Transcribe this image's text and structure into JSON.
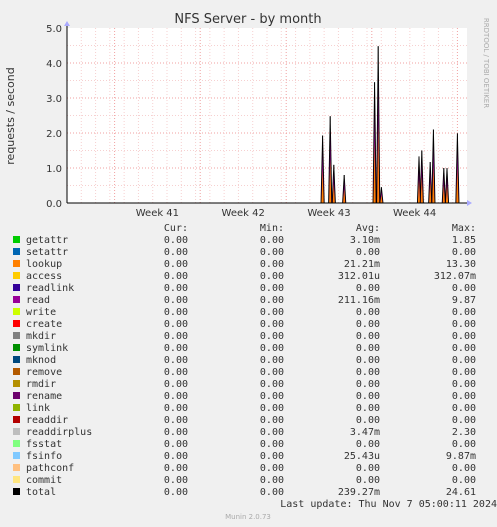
{
  "chart_data": {
    "type": "area",
    "title": "NFS Server - by month",
    "ylabel": "requests / second",
    "watermark": "RRDTOOL / TOBI OETIKER",
    "footer": "Munin 2.0.73",
    "ylim": [
      0,
      5
    ],
    "yticks": [
      "0.0",
      "1.0",
      "2.0",
      "3.0",
      "4.0",
      "5.0"
    ],
    "week_labels": [
      "Week 41",
      "Week 42",
      "Week 43",
      "Week 44"
    ],
    "grid": true,
    "spikes": [
      {
        "x": 0.639,
        "v": 1.93
      },
      {
        "x": 0.658,
        "v": 2.48
      },
      {
        "x": 0.667,
        "v": 1.09
      },
      {
        "x": 0.693,
        "v": 0.8
      },
      {
        "x": 0.769,
        "v": 3.45
      },
      {
        "x": 0.778,
        "v": 4.48
      },
      {
        "x": 0.786,
        "v": 0.45
      },
      {
        "x": 0.88,
        "v": 1.33
      },
      {
        "x": 0.887,
        "v": 1.5
      },
      {
        "x": 0.908,
        "v": 1.17
      },
      {
        "x": 0.916,
        "v": 2.1
      },
      {
        "x": 0.942,
        "v": 1.0
      },
      {
        "x": 0.95,
        "v": 1.0
      },
      {
        "x": 0.976,
        "v": 1.99
      }
    ],
    "headers": [
      "Cur:",
      "Min:",
      "Avg:",
      "Max:"
    ],
    "series": [
      {
        "name": "getattr",
        "color": "#00cc00",
        "cur": "0.00",
        "min": "0.00",
        "avg": "3.10m",
        "max": "1.85"
      },
      {
        "name": "setattr",
        "color": "#0066b3",
        "cur": "0.00",
        "min": "0.00",
        "avg": "0.00",
        "max": "0.00"
      },
      {
        "name": "lookup",
        "color": "#ff8000",
        "cur": "0.00",
        "min": "0.00",
        "avg": "21.21m",
        "max": "13.30"
      },
      {
        "name": "access",
        "color": "#ffcc00",
        "cur": "0.00",
        "min": "0.00",
        "avg": "312.01u",
        "max": "312.07m"
      },
      {
        "name": "readlink",
        "color": "#330099",
        "cur": "0.00",
        "min": "0.00",
        "avg": "0.00",
        "max": "0.00"
      },
      {
        "name": "read",
        "color": "#990099",
        "cur": "0.00",
        "min": "0.00",
        "avg": "211.16m",
        "max": "9.87"
      },
      {
        "name": "write",
        "color": "#ccff00",
        "cur": "0.00",
        "min": "0.00",
        "avg": "0.00",
        "max": "0.00"
      },
      {
        "name": "create",
        "color": "#ff0000",
        "cur": "0.00",
        "min": "0.00",
        "avg": "0.00",
        "max": "0.00"
      },
      {
        "name": "mkdir",
        "color": "#808080",
        "cur": "0.00",
        "min": "0.00",
        "avg": "0.00",
        "max": "0.00"
      },
      {
        "name": "symlink",
        "color": "#008f00",
        "cur": "0.00",
        "min": "0.00",
        "avg": "0.00",
        "max": "0.00"
      },
      {
        "name": "mknod",
        "color": "#00487d",
        "cur": "0.00",
        "min": "0.00",
        "avg": "0.00",
        "max": "0.00"
      },
      {
        "name": "remove",
        "color": "#b35a00",
        "cur": "0.00",
        "min": "0.00",
        "avg": "0.00",
        "max": "0.00"
      },
      {
        "name": "rmdir",
        "color": "#b38f00",
        "cur": "0.00",
        "min": "0.00",
        "avg": "0.00",
        "max": "0.00"
      },
      {
        "name": "rename",
        "color": "#6b006b",
        "cur": "0.00",
        "min": "0.00",
        "avg": "0.00",
        "max": "0.00"
      },
      {
        "name": "link",
        "color": "#8fb300",
        "cur": "0.00",
        "min": "0.00",
        "avg": "0.00",
        "max": "0.00"
      },
      {
        "name": "readdir",
        "color": "#b30000",
        "cur": "0.00",
        "min": "0.00",
        "avg": "0.00",
        "max": "0.00"
      },
      {
        "name": "readdirplus",
        "color": "#bebebe",
        "cur": "0.00",
        "min": "0.00",
        "avg": "3.47m",
        "max": "2.30"
      },
      {
        "name": "fsstat",
        "color": "#80ff80",
        "cur": "0.00",
        "min": "0.00",
        "avg": "0.00",
        "max": "0.00"
      },
      {
        "name": "fsinfo",
        "color": "#80c9ff",
        "cur": "0.00",
        "min": "0.00",
        "avg": "25.43u",
        "max": "9.87m"
      },
      {
        "name": "pathconf",
        "color": "#ffc080",
        "cur": "0.00",
        "min": "0.00",
        "avg": "0.00",
        "max": "0.00"
      },
      {
        "name": "commit",
        "color": "#ffe680",
        "cur": "0.00",
        "min": "0.00",
        "avg": "0.00",
        "max": "0.00"
      },
      {
        "name": "total",
        "color": "#000000",
        "cur": "0.00",
        "min": "0.00",
        "avg": "239.27m",
        "max": "24.61"
      }
    ],
    "last_update": "Last update: Thu Nov  7 05:00:11 2024"
  }
}
